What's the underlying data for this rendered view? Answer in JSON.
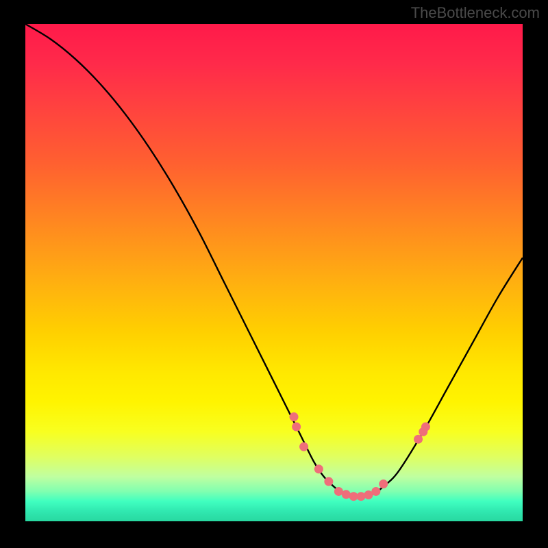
{
  "watermark": "TheBottleneck.com",
  "chart_data": {
    "type": "line",
    "title": "",
    "xlabel": "",
    "ylabel": "",
    "xlim": [
      0,
      100
    ],
    "ylim": [
      0,
      100
    ],
    "curve": {
      "x": [
        0,
        5,
        10,
        15,
        20,
        25,
        30,
        35,
        40,
        45,
        50,
        55,
        58,
        60,
        62,
        64,
        66,
        68,
        70,
        72,
        75,
        80,
        85,
        90,
        95,
        100
      ],
      "y": [
        100,
        97,
        93,
        88,
        82,
        75,
        67,
        58,
        48,
        38,
        28,
        18,
        12,
        9,
        7,
        5.5,
        5,
        5,
        5.5,
        7,
        10,
        18,
        27,
        36,
        45,
        53
      ]
    },
    "markers": {
      "x": [
        54,
        54.5,
        56,
        59,
        61,
        63,
        64.5,
        66,
        67.5,
        69,
        70.5,
        72,
        79,
        80,
        80.5
      ],
      "y": [
        21,
        19,
        15,
        10.5,
        8,
        6,
        5.4,
        5,
        5,
        5.3,
        6,
        7.5,
        16.5,
        18,
        19
      ]
    },
    "colors": {
      "curve": "#000000",
      "marker": "#ef6e7a"
    }
  }
}
